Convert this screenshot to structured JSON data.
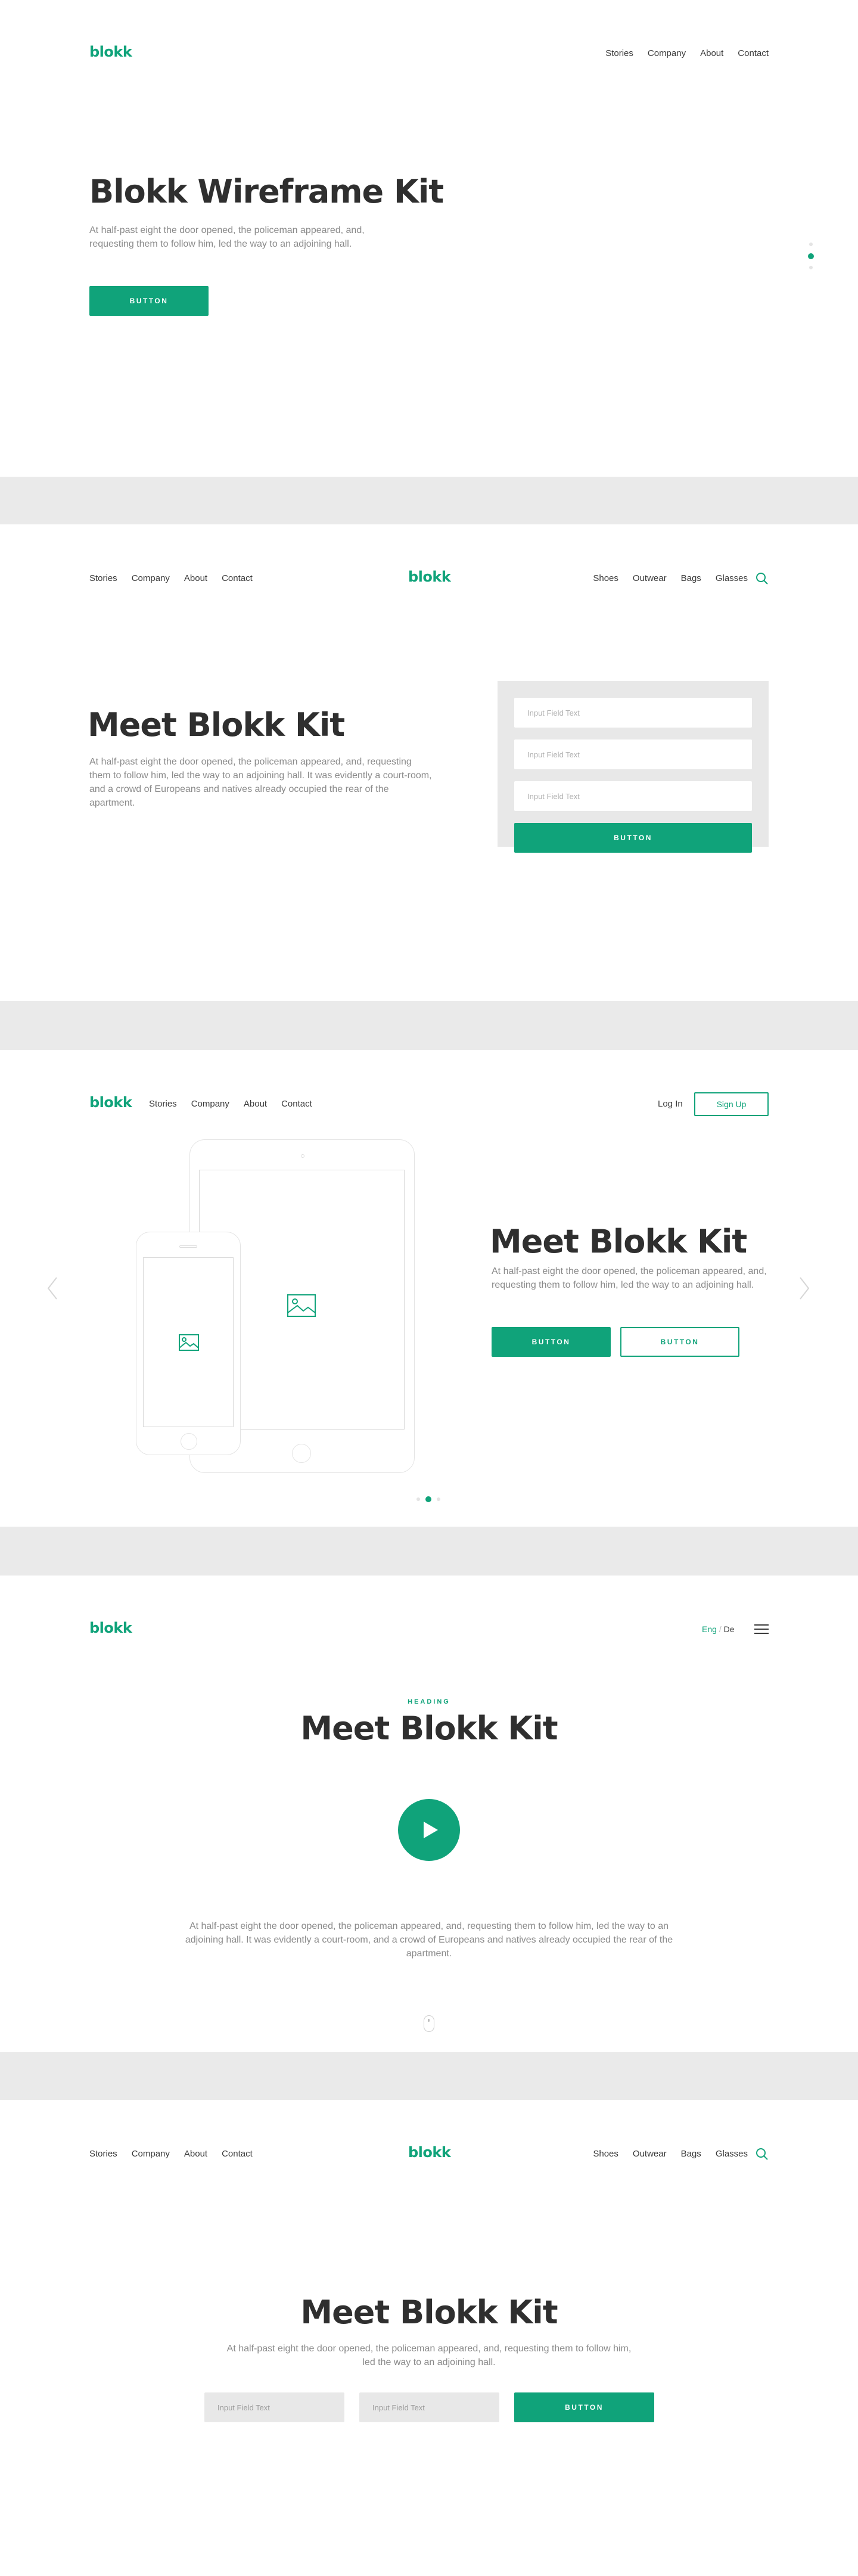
{
  "colors": {
    "brand": "#10a37a",
    "divider": "#eaeaea",
    "text": "#2f2f2f",
    "muted": "#8a8a8a"
  },
  "hero1": {
    "logo": "blokk",
    "nav": [
      "Stories",
      "Company",
      "About",
      "Contact"
    ],
    "title": "Blokk Wireframe Kit",
    "paragraph": "At half-past eight the door opened, the policeman appeared, and, requesting them to follow him, led the way to an adjoining hall.",
    "button": "BUTTON",
    "pager_active": 2,
    "pager_count": 3
  },
  "hero2": {
    "nav_left": [
      "Stories",
      "Company",
      "About",
      "Contact"
    ],
    "logo": "blokk",
    "nav_right": [
      "Shoes",
      "Outwear",
      "Bags",
      "Glasses"
    ],
    "search_icon": "search-icon",
    "title": "Meet Blokk Kit",
    "paragraph": "At half-past eight the door opened, the policeman appeared, and, requesting them to follow him, led the way to an adjoining hall. It was evidently a court-room, and a crowd of Europeans and natives already occupied the rear of the apartment.",
    "form": {
      "fields": [
        "Input Field Text",
        "Input Field Text",
        "Input Field Text"
      ],
      "button": "BUTTON"
    }
  },
  "hero3": {
    "logo": "blokk",
    "nav": [
      "Stories",
      "Company",
      "About",
      "Contact"
    ],
    "login": "Log In",
    "signup": "Sign Up",
    "title": "Meet Blokk Kit",
    "paragraph": "At half-past eight the door opened, the policeman appeared, and, requesting them to follow him, led the way to an adjoining hall.",
    "button_primary": "BUTTON",
    "button_secondary": "BUTTON",
    "carousel_active": 2,
    "carousel_count": 3
  },
  "hero4": {
    "logo": "blokk",
    "lang_active": "Eng",
    "lang_sep": "/",
    "lang_other": "De",
    "eyebrow": "HEADING",
    "title": "Meet Blokk Kit",
    "paragraph": "At half-past eight the door opened, the policeman appeared, and, requesting them to follow him, led the way to an adjoining hall. It was evidently a court-room, and a crowd of Europeans and natives already occupied the rear of the apartment."
  },
  "hero5": {
    "nav_left": [
      "Stories",
      "Company",
      "About",
      "Contact"
    ],
    "logo": "blokk",
    "nav_right": [
      "Shoes",
      "Outwear",
      "Bags",
      "Glasses"
    ],
    "title": "Meet Blokk Kit",
    "paragraph": "At half-past eight the door opened, the policeman appeared, and, requesting them to follow him, led the way to an adjoining hall.",
    "fields": [
      "Input Field Text",
      "Input Field Text"
    ],
    "button": "BUTTON"
  }
}
